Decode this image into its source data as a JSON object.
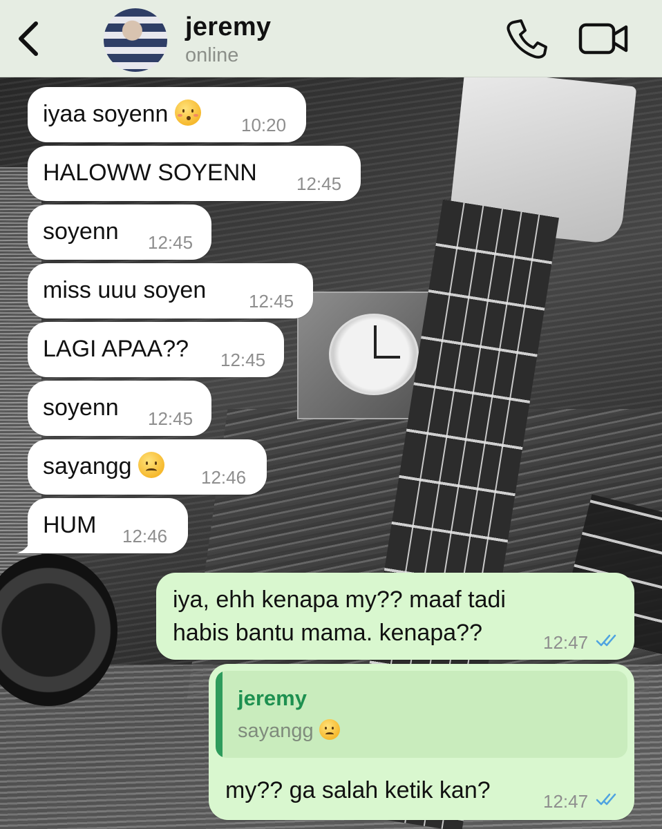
{
  "header": {
    "contact_name": "jeremy",
    "contact_status": "online",
    "icons": [
      "back-chevron-icon",
      "avatar",
      "phone-icon",
      "video-camera-icon"
    ]
  },
  "colors": {
    "header_bg": "#e6ede3",
    "incoming_bubble": "#ffffff",
    "outgoing_bubble": "#d9f7cf",
    "reply_accent": "#2e9b5c",
    "read_ticks": "#4fa3e0"
  },
  "messages": [
    {
      "direction": "in",
      "text": "iyaa soyenn",
      "emoji": "kissing-closed-eyes",
      "time": "10:20"
    },
    {
      "direction": "in",
      "text": "HALOWW SOYENN",
      "time": "12:45"
    },
    {
      "direction": "in",
      "text": "soyenn",
      "time": "12:45"
    },
    {
      "direction": "in",
      "text": "miss uuu soyen",
      "time": "12:45"
    },
    {
      "direction": "in",
      "text": "LAGI APAA??",
      "time": "12:45"
    },
    {
      "direction": "in",
      "text": "soyenn",
      "time": "12:45"
    },
    {
      "direction": "in",
      "text": "sayangg",
      "emoji": "frowning-face",
      "time": "12:46"
    },
    {
      "direction": "in",
      "text": "HUM",
      "time": "12:46"
    },
    {
      "direction": "out",
      "line1": "iya, ehh kenapa my?? maaf tadi",
      "line2": "habis bantu mama. kenapa??",
      "time": "12:47",
      "status": "read"
    },
    {
      "direction": "out",
      "reply_to": {
        "name": "jeremy",
        "text": "sayangg",
        "emoji": "frowning-face"
      },
      "text": "my?? ga salah ketik kan?",
      "time": "12:47",
      "status": "read"
    }
  ]
}
